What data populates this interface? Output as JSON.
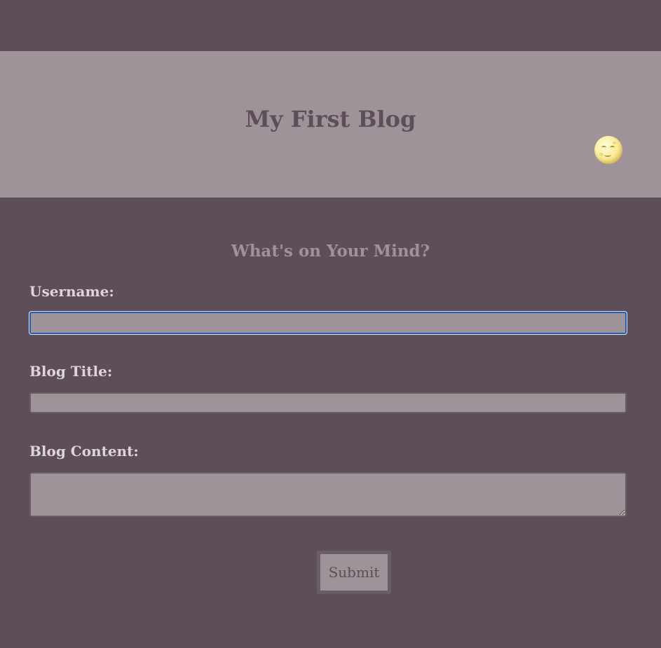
{
  "header": {
    "title": "My First Blog",
    "theme_toggle_icon": "moon-face-icon"
  },
  "form": {
    "heading": "What's on Your Mind?",
    "username": {
      "label": "Username:",
      "value": "",
      "focused": true
    },
    "blog_title": {
      "label": "Blog Title:",
      "value": ""
    },
    "blog_content": {
      "label": "Blog Content:",
      "value": ""
    },
    "submit_label": "Submit"
  },
  "colors": {
    "background": "#5d4e58",
    "header_background": "#9d9398",
    "input_background": "#9d9398",
    "label_text": "#ddd5da",
    "focus_ring": "#1f5fb4"
  }
}
